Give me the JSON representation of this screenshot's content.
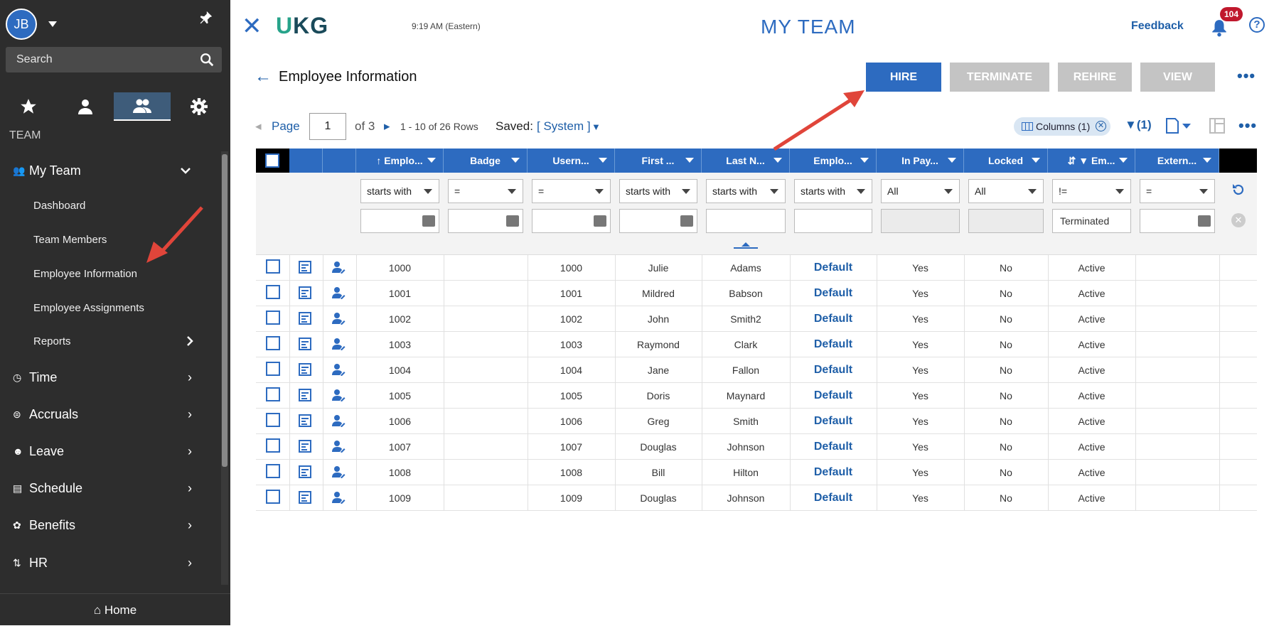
{
  "sidebar": {
    "user_initials": "JB",
    "search_placeholder": "Search",
    "section_label": "TEAM",
    "my_team": "My Team",
    "sub_items": [
      "Dashboard",
      "Team Members",
      "Employee Information",
      "Employee Assignments",
      "Reports"
    ],
    "groups": [
      "Time",
      "Accruals",
      "Leave",
      "Schedule",
      "Benefits",
      "HR"
    ],
    "home": "Home"
  },
  "topbar": {
    "logo": "UKG",
    "time": "9:19 AM (Eastern)",
    "title": "MY TEAM",
    "feedback": "Feedback",
    "notification_count": "104",
    "help": "?"
  },
  "page": {
    "title": "Employee Information",
    "buttons": {
      "hire": "HIRE",
      "terminate": "TERMINATE",
      "rehire": "REHIRE",
      "view": "VIEW"
    }
  },
  "pager": {
    "page_label": "Page",
    "page_value": "1",
    "of_label": "of 3",
    "range": "1 - 10 of 26 Rows",
    "saved_label": "Saved:",
    "saved_value": "[ System ]"
  },
  "toolbar": {
    "columns_chip": "Columns (1)",
    "filter_count": "(1)"
  },
  "table": {
    "columns": [
      "Emplo...",
      "Badge",
      "Usern...",
      "First ...",
      "Last N...",
      "Emplo...",
      "In Pay...",
      "Locked",
      "Em...",
      "Extern..."
    ],
    "filter_ops": [
      "starts with",
      "=",
      "=",
      "starts with",
      "starts with",
      "starts with",
      "All",
      "All",
      "!=",
      "="
    ],
    "filter_values": [
      "",
      "",
      "",
      "",
      "",
      "",
      "",
      "",
      "Terminated",
      ""
    ],
    "rows": [
      [
        "1000",
        "",
        "1000",
        "Julie",
        "Adams",
        "Default",
        "Yes",
        "No",
        "Active",
        ""
      ],
      [
        "1001",
        "",
        "1001",
        "Mildred",
        "Babson",
        "Default",
        "Yes",
        "No",
        "Active",
        ""
      ],
      [
        "1002",
        "",
        "1002",
        "John",
        "Smith2",
        "Default",
        "Yes",
        "No",
        "Active",
        ""
      ],
      [
        "1003",
        "",
        "1003",
        "Raymond",
        "Clark",
        "Default",
        "Yes",
        "No",
        "Active",
        ""
      ],
      [
        "1004",
        "",
        "1004",
        "Jane",
        "Fallon",
        "Default",
        "Yes",
        "No",
        "Active",
        ""
      ],
      [
        "1005",
        "",
        "1005",
        "Doris",
        "Maynard",
        "Default",
        "Yes",
        "No",
        "Active",
        ""
      ],
      [
        "1006",
        "",
        "1006",
        "Greg",
        "Smith",
        "Default",
        "Yes",
        "No",
        "Active",
        ""
      ],
      [
        "1007",
        "",
        "1007",
        "Douglas",
        "Johnson",
        "Default",
        "Yes",
        "No",
        "Active",
        ""
      ],
      [
        "1008",
        "",
        "1008",
        "Bill",
        "Hilton",
        "Default",
        "Yes",
        "No",
        "Active",
        ""
      ],
      [
        "1009",
        "",
        "1009",
        "Douglas",
        "Johnson",
        "Default",
        "Yes",
        "No",
        "Active",
        ""
      ]
    ]
  },
  "colors": {
    "primary": "#2d6bc0",
    "sidebar_bg": "#2d2d2d",
    "disabled_btn": "#c4c4c4",
    "arrow": "#e0453a",
    "badge": "#c0182d"
  }
}
